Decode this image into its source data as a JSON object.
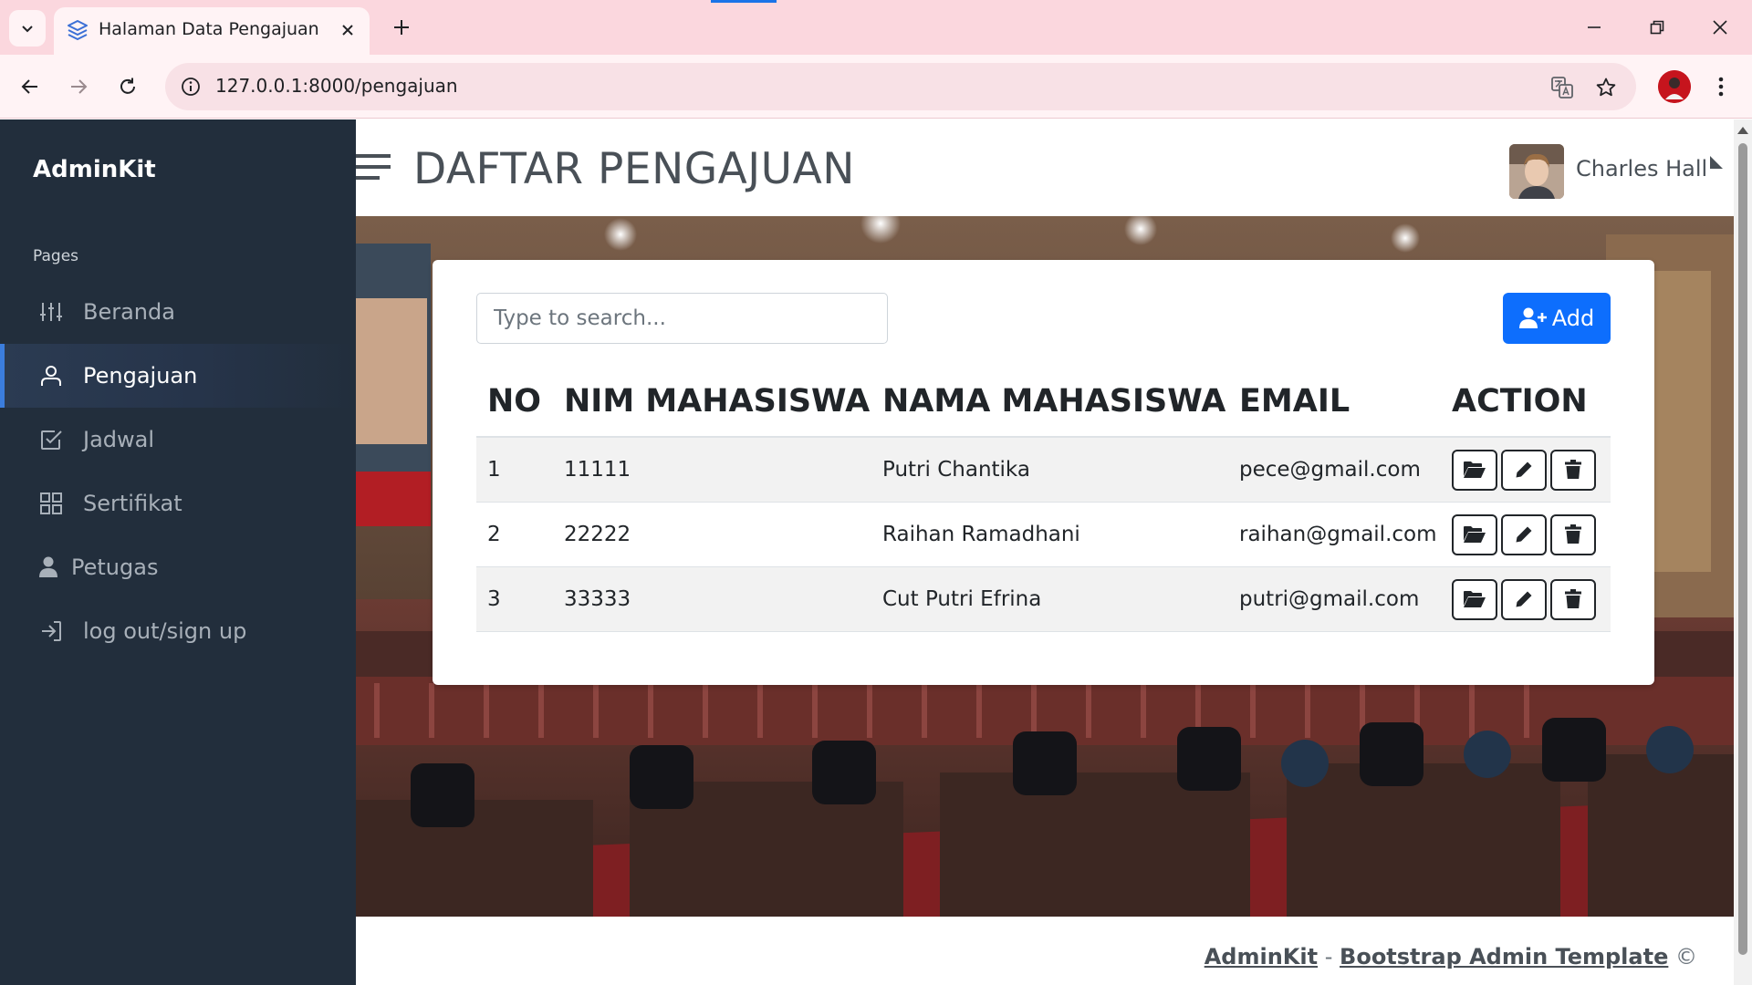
{
  "browser": {
    "tab_title": "Halaman Data Pengajuan",
    "url": "127.0.0.1:8000/pengajuan"
  },
  "sidebar": {
    "brand": "AdminKit",
    "header": "Pages",
    "items": [
      {
        "label": "Beranda",
        "icon": "sliders-icon"
      },
      {
        "label": "Pengajuan",
        "icon": "user-icon",
        "active": true
      },
      {
        "label": "Jadwal",
        "icon": "check-square-icon"
      },
      {
        "label": "Sertifikat",
        "icon": "grid-icon"
      },
      {
        "label": "Petugas",
        "icon": "person-icon"
      },
      {
        "label": "log out/sign up",
        "icon": "log-in-icon"
      }
    ]
  },
  "header": {
    "title": "DAFTAR PENGAJUAN",
    "user_name": "Charles Hall"
  },
  "search": {
    "placeholder": "Type to search...",
    "value": ""
  },
  "toolbar": {
    "add_label": "Add"
  },
  "table": {
    "columns": [
      "NO",
      "NIM MAHASISWA",
      "NAMA MAHASISWA",
      "EMAIL",
      "ACTION"
    ],
    "rows": [
      {
        "no": "1",
        "nim": "11111",
        "nama": "Putri Chantika",
        "email": "pece@gmail.com"
      },
      {
        "no": "2",
        "nim": "22222",
        "nama": "Raihan Ramadhani",
        "email": "raihan@gmail.com"
      },
      {
        "no": "3",
        "nim": "33333",
        "nama": "Cut Putri Efrina",
        "email": "putri@gmail.com"
      }
    ]
  },
  "footer": {
    "brand_link": "AdminKit",
    "separator": "-",
    "template_link": "Bootstrap Admin Template",
    "copyright": "©"
  },
  "colors": {
    "sidebar_bg": "#222e3c",
    "accent": "#3b7ddd",
    "primary_button": "#0d6efd",
    "tab_strip": "#fbd7de"
  }
}
